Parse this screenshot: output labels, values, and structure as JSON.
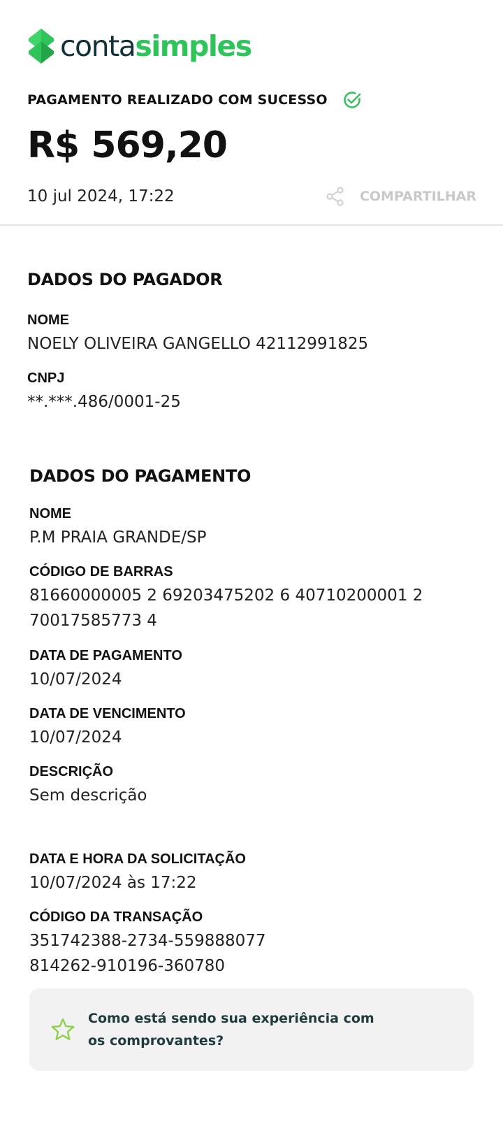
{
  "brand": {
    "word1": "conta",
    "word2": "simples",
    "color_dark": "#12323a",
    "color_green": "#2fc45a"
  },
  "header": {
    "status": "PAGAMENTO REALIZADO COM SUCESSO",
    "status_icon": "check-circle-icon",
    "amount": "R$ 569,20",
    "datetime": "10 jul 2024, 17:22",
    "share_label": "COMPARTILHAR",
    "share_icon": "share-icon"
  },
  "payer": {
    "title": "DADOS DO PAGADOR",
    "fields": [
      {
        "label": "NOME",
        "value": "NOELY OLIVEIRA GANGELLO 42112991825"
      },
      {
        "label": "CNPJ",
        "value": "**.***.486/0001-25"
      }
    ]
  },
  "payment": {
    "title": "DADOS DO PAGAMENTO",
    "fields": [
      {
        "label": "NOME",
        "value": "P.M PRAIA GRANDE/SP"
      },
      {
        "label": "CÓDIGO DE BARRAS",
        "value_line1": "81660000005 2 69203475202 6 40710200001 2",
        "value_line2": "70017585773 4"
      },
      {
        "label": "DATA DE PAGAMENTO",
        "value": "10/07/2024"
      },
      {
        "label": "DATA DE VENCIMENTO",
        "value": "10/07/2024"
      },
      {
        "label": "DESCRIÇÃO",
        "value": "Sem descrição"
      },
      {
        "label": "DATA E HORA DA SOLICITAÇÃO",
        "value": "10/07/2024 às 17:22"
      },
      {
        "label": "CÓDIGO DA TRANSAÇÃO",
        "value_line1": "351742388-2734-559888077",
        "value_line2": "814262-910196-360780"
      }
    ]
  },
  "feedback": {
    "icon": "star-icon",
    "text": "Como está sendo sua experiência com os comprovantes?"
  }
}
